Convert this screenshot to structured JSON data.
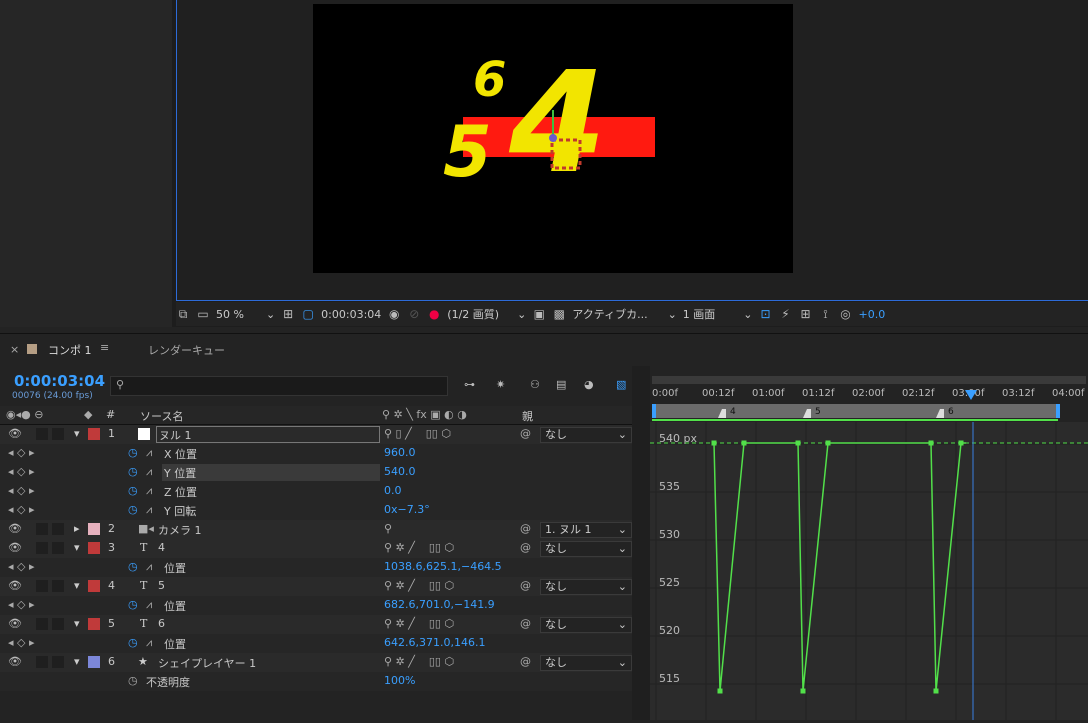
{
  "viewer": {
    "comp_numbers": {
      "six": "6",
      "five": "5",
      "four": "4"
    },
    "zoom": "50 %",
    "timecode": "0:00:03:04",
    "resolution": "(1/2 画質)",
    "camera": "アクティブカ...",
    "views": "1 画面",
    "exposure": "+0.0"
  },
  "tabs": {
    "comp": "コンポ 1",
    "render": "レンダーキュー"
  },
  "timeline": {
    "current_time": "0:00:03:04",
    "frame_info": "00076 (24.00 fps)",
    "search_placeholder": "",
    "header": {
      "num": "#",
      "source": "ソース名",
      "parent": "親"
    },
    "rows": [
      {
        "num": "1",
        "name": "ヌル 1",
        "parent": "なし"
      },
      {
        "prop": "X 位置",
        "value": "960.0"
      },
      {
        "prop": "Y 位置",
        "value": "540.0"
      },
      {
        "prop": "Z 位置",
        "value": "0.0"
      },
      {
        "prop": "Y 回転",
        "value": "0x−7.3°"
      },
      {
        "num": "2",
        "name": "カメラ 1",
        "parent": "1. ヌル 1"
      },
      {
        "num": "3",
        "name": "4",
        "parent": "なし"
      },
      {
        "prop": "位置",
        "value": "1038.6,625.1,−464.5"
      },
      {
        "num": "4",
        "name": "5",
        "parent": "なし"
      },
      {
        "prop": "位置",
        "value": "682.6,701.0,−141.9"
      },
      {
        "num": "5",
        "name": "6",
        "parent": "なし"
      },
      {
        "prop": "位置",
        "value": "642.6,371.0,146.1"
      },
      {
        "num": "6",
        "name": "シェイプレイヤー 1",
        "parent": "なし"
      },
      {
        "prop": "不透明度",
        "value": "100%"
      }
    ]
  },
  "ruler": {
    "ticks": [
      "0:00f",
      "00:12f",
      "01:00f",
      "01:12f",
      "02:00f",
      "02:12f",
      "03:00f",
      "03:12f",
      "04:00f"
    ],
    "markers": [
      "4",
      "5",
      "6"
    ]
  },
  "graph": {
    "y_labels": [
      "540 px",
      "535",
      "530",
      "525",
      "520",
      "515"
    ]
  },
  "colors": {
    "accent": "#3a9fff",
    "layer_red": "#c03a3a",
    "layer_pink": "#e6b1be",
    "layer_blue": "#7c87d9",
    "curve": "#52e04a"
  }
}
